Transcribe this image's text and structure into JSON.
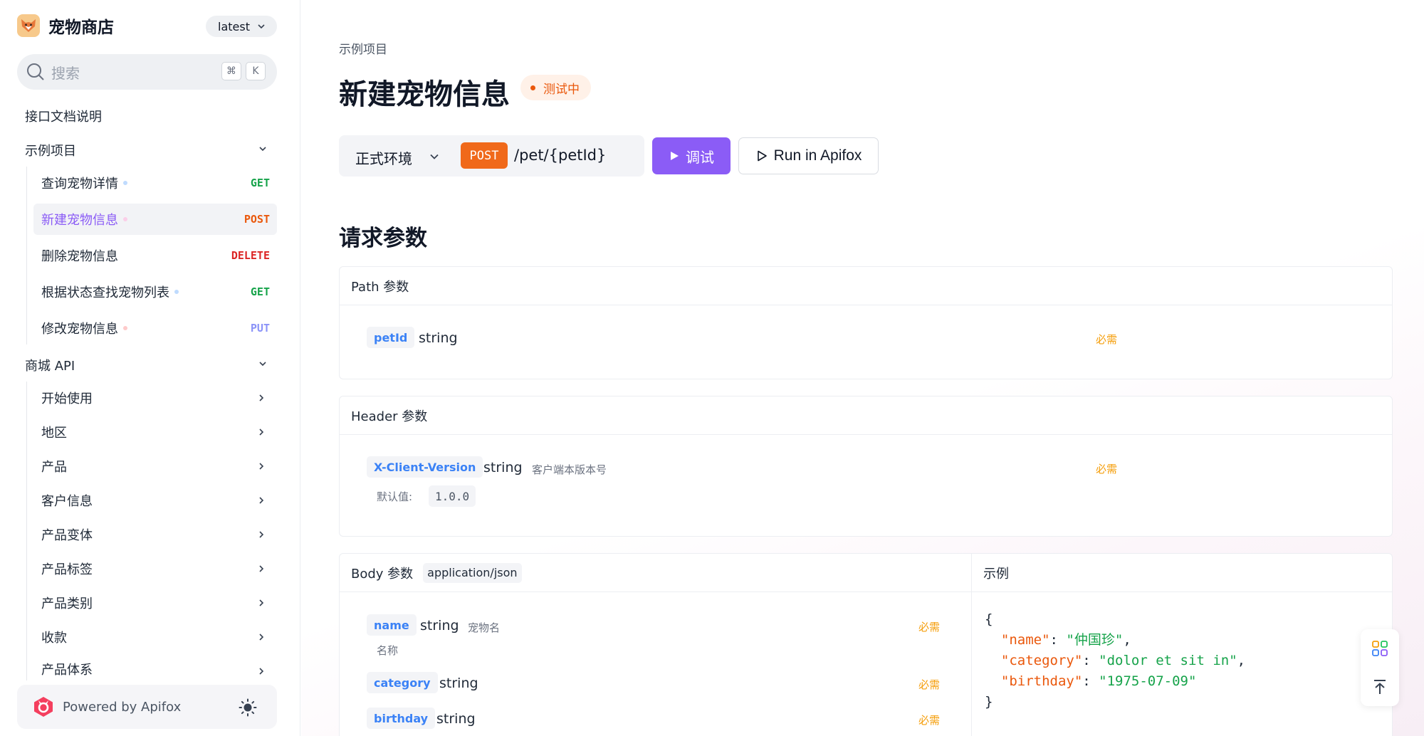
{
  "sidebar": {
    "brand": "宠物商店",
    "version": "latest",
    "search_placeholder": "搜索",
    "shortcut_keys": [
      "⌘",
      "K"
    ],
    "doc_link": "接口文档说明",
    "group1": {
      "label": "示例项目",
      "items": [
        {
          "label": "查询宠物详情",
          "method": "GET",
          "method_color": "#16a34a",
          "dot_color": "#bfdbfe"
        },
        {
          "label": "新建宠物信息",
          "method": "POST",
          "method_color": "#ea580c",
          "dot_color": "#fbcfe8"
        },
        {
          "label": "删除宠物信息",
          "method": "DELETE",
          "method_color": "#dc2626"
        },
        {
          "label": "根据状态查找宠物列表",
          "method": "GET",
          "method_color": "#16a34a",
          "dot_color": "#bfdbfe"
        },
        {
          "label": "修改宠物信息",
          "method": "PUT",
          "method_color": "#8b93f8",
          "dot_color": "#fecaca"
        }
      ]
    },
    "group2": {
      "label": "商城 API",
      "items": [
        "开始使用",
        "地区",
        "产品",
        "客户信息",
        "产品变体",
        "产品标签",
        "产品类别",
        "收款",
        "产品体系"
      ]
    },
    "footer": "Powered by Apifox"
  },
  "main": {
    "breadcrumb": "示例项目",
    "title": "新建宠物信息",
    "status": "测试中",
    "environment": "正式环境",
    "method": "POST",
    "path": "/pet/{petId}",
    "debug_label": "调试",
    "run_label": "Run in Apifox",
    "section_title": "请求参数",
    "path_params": {
      "title": "Path 参数",
      "name": "petId",
      "type": "string",
      "required": "必需"
    },
    "header_params": {
      "title": "Header 参数",
      "name": "X-Client-Version",
      "type": "string",
      "desc": "客户端本版本号",
      "required": "必需",
      "default_label": "默认值:",
      "default_value": "1.0.0"
    },
    "body_params": {
      "title": "Body 参数",
      "content_type": "application/json",
      "fields": [
        {
          "name": "name",
          "type": "string",
          "desc": "宠物名",
          "sub": "名称",
          "required": "必需"
        },
        {
          "name": "category",
          "type": "string",
          "required": "必需"
        },
        {
          "name": "birthday",
          "type": "string",
          "required": "必需"
        }
      ]
    },
    "example": {
      "title": "示例",
      "open": "{",
      "close": "}",
      "lines": [
        {
          "key": "\"name\"",
          "value": "\"仲国珍\"",
          "tail": ","
        },
        {
          "key": "\"category\"",
          "value": "\"dolor et sit in\"",
          "tail": ","
        },
        {
          "key": "\"birthday\"",
          "value": "\"1975-07-09\"",
          "tail": ""
        }
      ]
    }
  }
}
